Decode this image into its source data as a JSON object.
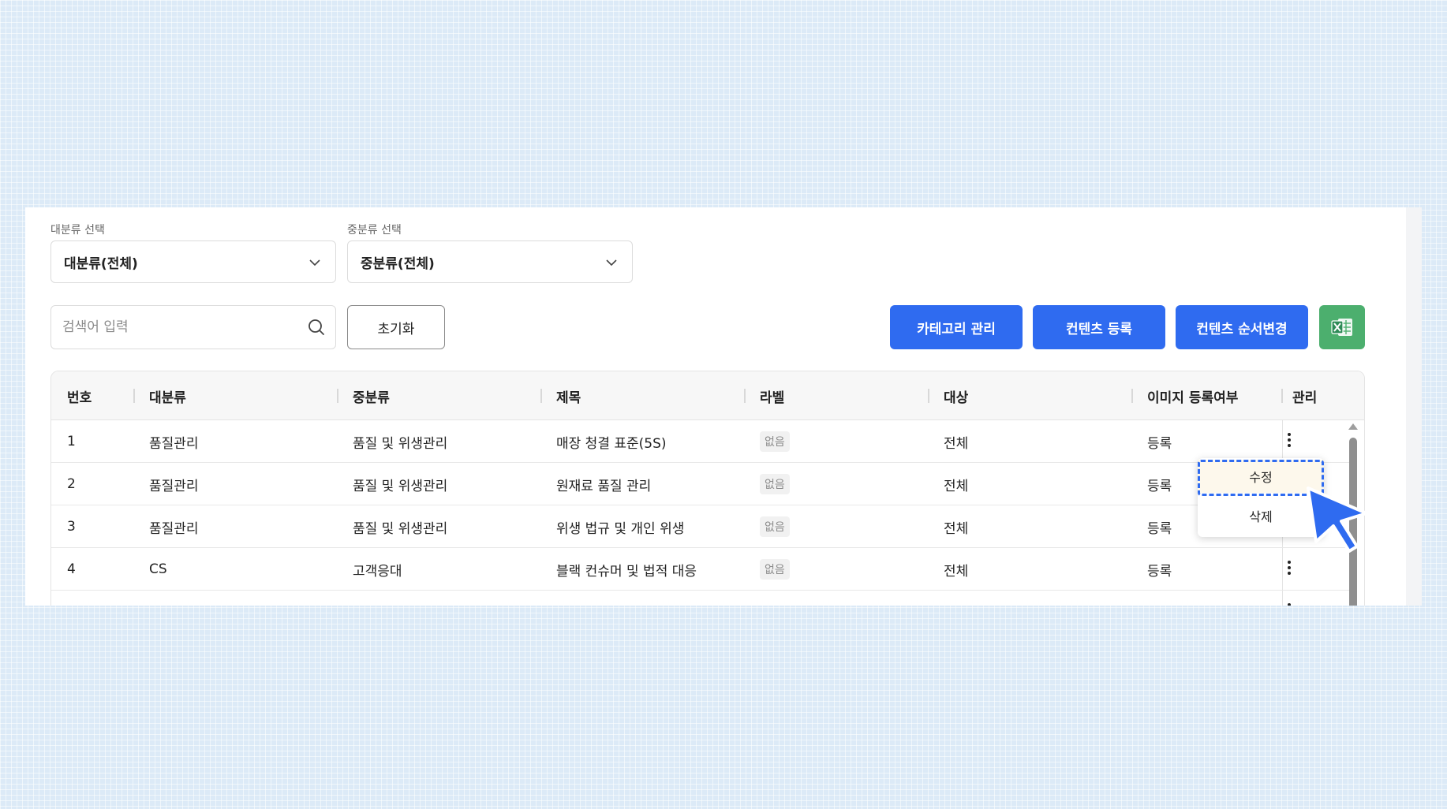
{
  "filters": {
    "major": {
      "label": "대분류 선택",
      "value": "대분류(전체)"
    },
    "middle": {
      "label": "중분류 선택",
      "value": "중분류(전체)"
    }
  },
  "search": {
    "placeholder": "검색어 입력",
    "value": ""
  },
  "buttons": {
    "reset": "초기화",
    "category": "카테고리 관리",
    "register": "컨텐츠 등록",
    "reorder": "컨텐츠 순서변경"
  },
  "table": {
    "headers": [
      "번호",
      "대분류",
      "중분류",
      "제목",
      "라벨",
      "대상",
      "이미지 등록여부",
      "관리"
    ],
    "rows": [
      {
        "no": "1",
        "major": "품질관리",
        "middle": "품질 및 위생관리",
        "title": "매장 청결 표준(5S)",
        "label": "없음",
        "target": "전체",
        "image": "등록"
      },
      {
        "no": "2",
        "major": "품질관리",
        "middle": "품질 및 위생관리",
        "title": "원재료 품질 관리",
        "label": "없음",
        "target": "전체",
        "image": "등록"
      },
      {
        "no": "3",
        "major": "품질관리",
        "middle": "품질 및 위생관리",
        "title": "위생 법규 및 개인 위생",
        "label": "없음",
        "target": "전체",
        "image": "등록"
      },
      {
        "no": "4",
        "major": "CS",
        "middle": "고객응대",
        "title": "블랙 컨슈머 및 법적 대응",
        "label": "없음",
        "target": "전체",
        "image": "등록"
      }
    ]
  },
  "menu": {
    "edit": "수정",
    "delete": "삭제"
  },
  "colors": {
    "primary": "#2f6bf0",
    "excel": "#4caf6e",
    "highlight": "#fdf8ec"
  },
  "icons": {
    "search": "search-icon",
    "dropdown": "chevron-down-icon",
    "excel": "excel-icon",
    "more": "more-vertical-icon",
    "cursor": "cursor-icon"
  }
}
